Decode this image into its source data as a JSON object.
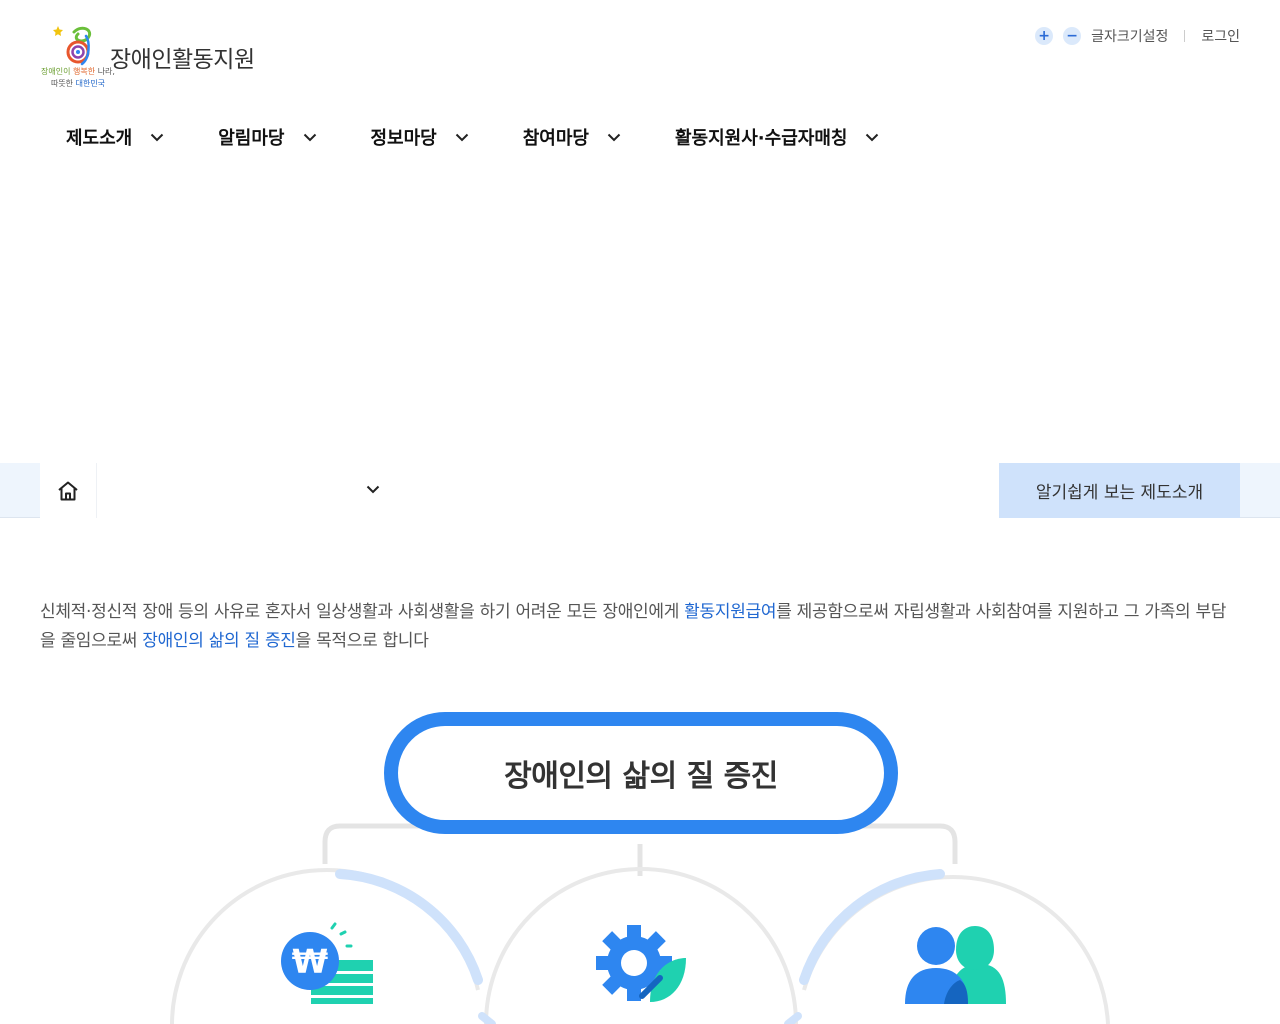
{
  "header": {
    "logo": {
      "title": "장애인활동지원",
      "slogan_line1_a": "장애인이",
      "slogan_line1_b": "행복한",
      "slogan_line1_c": "나라,",
      "slogan_line2_a": "따뜻한",
      "slogan_line2_b": "대한민국"
    },
    "util": {
      "font_increase": "+",
      "font_decrease": "−",
      "font_setting": "글자크기설정",
      "login": "로그인"
    },
    "nav": [
      {
        "label": "제도소개"
      },
      {
        "label": "알림마당"
      },
      {
        "label": "정보마당"
      },
      {
        "label": "참여마당"
      },
      {
        "label": "활동지원사·수급자매칭"
      }
    ]
  },
  "location_bar": {
    "home_icon": "home-icon",
    "select_value": "",
    "easy_intro": "알기쉽게 보는 제도소개"
  },
  "intro": {
    "part1": "신체적·정신적 장애 등의 사유로 혼자서 일상생활과 사회생활을 하기 어려운 모든 장애인에게 ",
    "highlight1": "활동지원급여",
    "part2": "를 제공함으로써 자립생활과 사회참여를 지원하고 그 가족의 부담을 줄임으로써 ",
    "highlight2": "장애인의 삶의 질 증진",
    "part3": "을 목적으로 합니다"
  },
  "diagram": {
    "goal": "장애인의 삶의 질 증진",
    "icons": [
      "won-money-icon",
      "gear-icon",
      "people-icon"
    ]
  },
  "colors": {
    "primary": "#2e86f0",
    "highlight_text": "#1f67d1",
    "mint": "#1fd1b0",
    "location_bg": "#eef5fd",
    "easy_button_bg": "#cfe2fb"
  }
}
